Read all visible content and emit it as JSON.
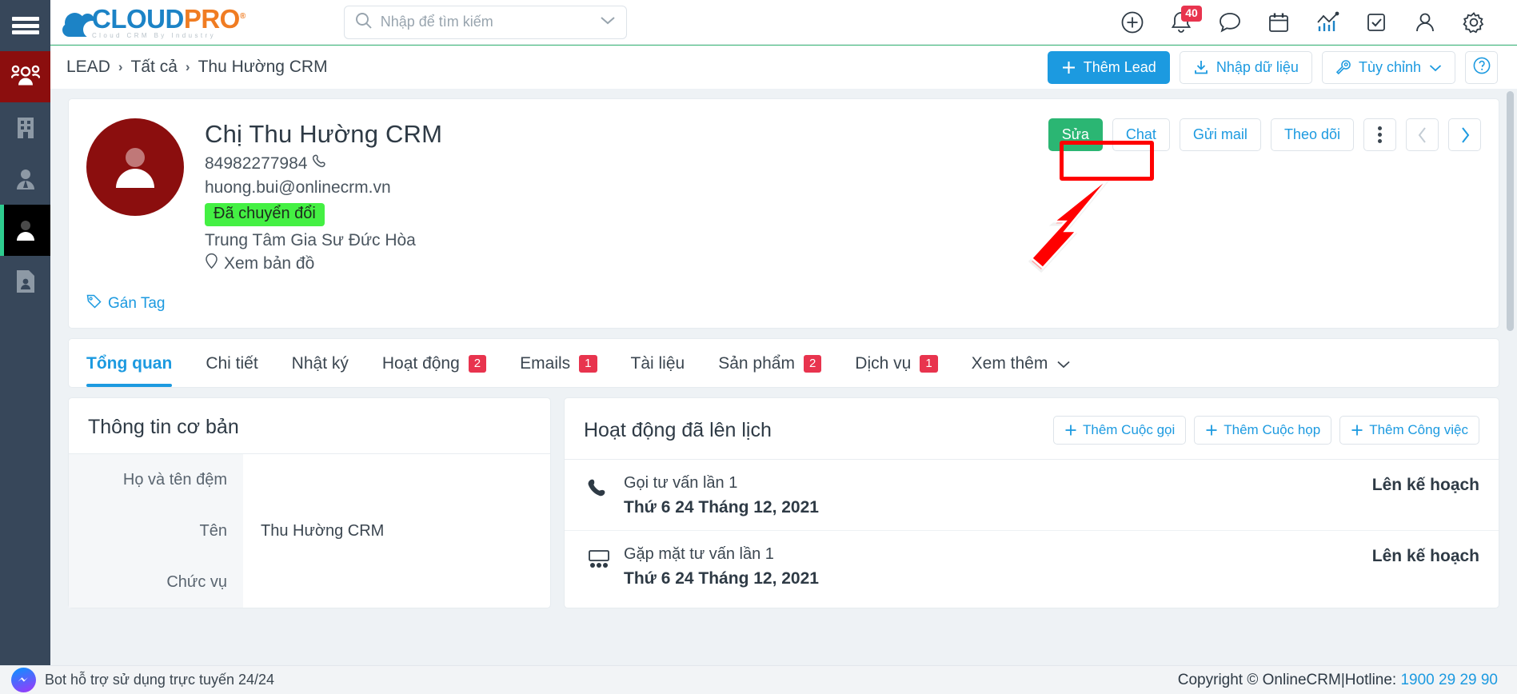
{
  "sidebar": {
    "menu_icon": "hamburger-icon",
    "items": [
      {
        "icon": "users-group-icon",
        "state": "hover"
      },
      {
        "icon": "building-icon",
        "state": "normal"
      },
      {
        "icon": "user-tie-icon",
        "state": "normal"
      },
      {
        "icon": "person-icon",
        "state": "selected"
      },
      {
        "icon": "contact-card-icon",
        "state": "normal"
      }
    ]
  },
  "brand": {
    "name_primary": "CLOUD",
    "name_secondary": "PRO",
    "registered_mark": "®",
    "tagline": "Cloud CRM By Industry",
    "color_primary": "#1c83c6",
    "color_secondary": "#f07c22"
  },
  "search": {
    "placeholder": "Nhập để tìm kiếm",
    "value": "",
    "icon": "search-icon",
    "dropdown_icon": "chevron-down-icon"
  },
  "top_icons": [
    {
      "name": "add-circle-icon",
      "badge": ""
    },
    {
      "name": "bell-icon",
      "badge": "40"
    },
    {
      "name": "chat-bubble-icon",
      "badge": ""
    },
    {
      "name": "calendar-icon",
      "badge": ""
    },
    {
      "name": "analytics-icon",
      "badge": ""
    },
    {
      "name": "task-check-icon",
      "badge": ""
    },
    {
      "name": "user-icon",
      "badge": ""
    },
    {
      "name": "gear-icon",
      "badge": ""
    }
  ],
  "breadcrumb": {
    "items": [
      "LEAD",
      "Tất cả",
      "Thu Hường CRM"
    ],
    "separator": "›"
  },
  "page_actions": {
    "add_lead": "Thêm Lead",
    "import": "Nhập dữ liệu",
    "customize": "Tùy chỉnh",
    "help": "?"
  },
  "contact": {
    "name": "Chị Thu Hường CRM",
    "phone": "84982277984",
    "email": "huong.bui@onlinecrm.vn",
    "status_label": "Đã chuyển đổi",
    "status_color": "#44f043",
    "company": "Trung Tâm Gia Sư Đức Hòa",
    "map_link": "Xem bản đồ",
    "tag_link": "Gán Tag",
    "avatar_color": "#8b0e0e",
    "actions": {
      "edit": "Sửa",
      "chat": "Chat",
      "send_mail": "Gửi mail",
      "follow": "Theo dõi",
      "more": "more-vertical-icon",
      "prev": "‹",
      "next": "›"
    }
  },
  "annotation": {
    "highlight_target": "Chat",
    "highlight_color": "#ff0000",
    "arrow_color": "#ff0000"
  },
  "tabs": [
    {
      "label": "Tổng quan",
      "badge": "",
      "active": true
    },
    {
      "label": "Chi tiết",
      "badge": "",
      "active": false
    },
    {
      "label": "Nhật ký",
      "badge": "",
      "active": false
    },
    {
      "label": "Hoạt động",
      "badge": "2",
      "active": false
    },
    {
      "label": "Emails",
      "badge": "1",
      "active": false
    },
    {
      "label": "Tài liệu",
      "badge": "",
      "active": false
    },
    {
      "label": "Sản phẩm",
      "badge": "2",
      "active": false
    },
    {
      "label": "Dịch vụ",
      "badge": "1",
      "active": false
    },
    {
      "label": "Xem thêm",
      "badge": "",
      "active": false,
      "dropdown": true
    }
  ],
  "basic_info": {
    "title": "Thông tin cơ bản",
    "fields": [
      {
        "label": "Họ và tên đệm",
        "value": ""
      },
      {
        "label": "Tên",
        "value": "Thu Hường CRM"
      },
      {
        "label": "Chức vụ",
        "value": ""
      }
    ]
  },
  "scheduled": {
    "title": "Hoạt động đã lên lịch",
    "actions": [
      {
        "label": "Thêm Cuộc gọi"
      },
      {
        "label": "Thêm Cuộc họp"
      },
      {
        "label": "Thêm Công việc"
      }
    ],
    "rows": [
      {
        "icon": "phone-icon",
        "title": "Gọi tư vấn lần 1",
        "date": "Thứ 6 24 Tháng 12, 2021",
        "status": "Lên kế hoạch"
      },
      {
        "icon": "meeting-icon",
        "title": "Gặp mặt tư vấn lần 1",
        "date": "Thứ 6 24 Tháng 12, 2021",
        "status": "Lên kế hoạch"
      }
    ]
  },
  "footer": {
    "bot_text": "Bot hỗ trợ sử dụng trực tuyến 24/24",
    "copyright": "Copyright © OnlineCRM",
    "separator": "|",
    "hotline_label": "Hotline:",
    "hotline_number": "1900 29 29 90"
  }
}
